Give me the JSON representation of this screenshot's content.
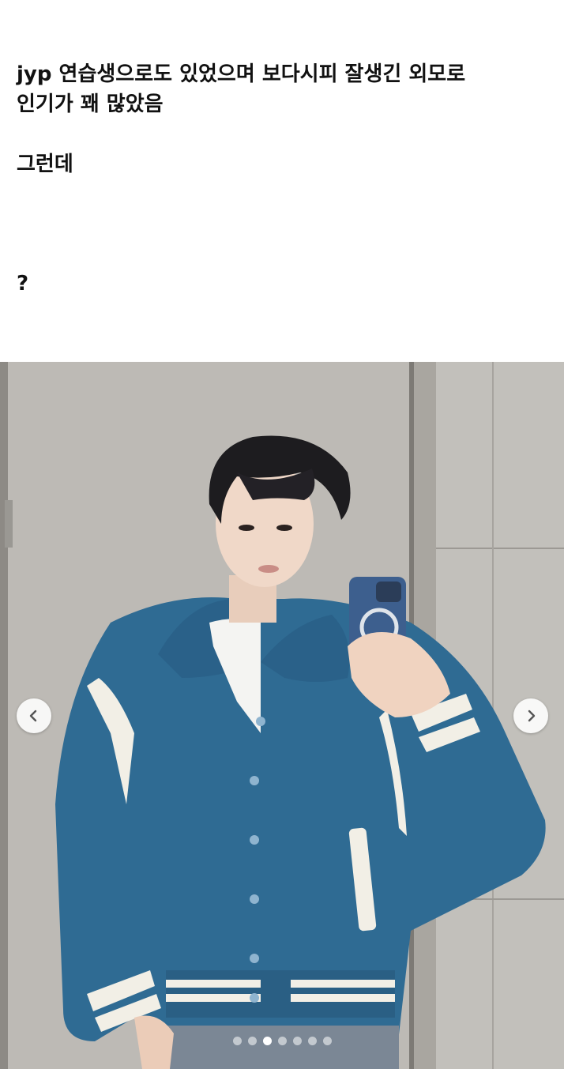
{
  "post": {
    "line1": "jyp 연습생으로도 있었으며 보다시피 잘생긴 외모로",
    "line2": "인기가 꽤 많았음",
    "line3": "그런데",
    "line4": "?"
  },
  "carousel": {
    "prev_icon": "chevron-left-icon",
    "next_icon": "chevron-right-icon",
    "slide_count": 7,
    "active_index": 2
  },
  "colors": {
    "jacket": "#2f6b93",
    "jacket_stripe": "#f2efe6",
    "wall": "#b9b6b1"
  }
}
